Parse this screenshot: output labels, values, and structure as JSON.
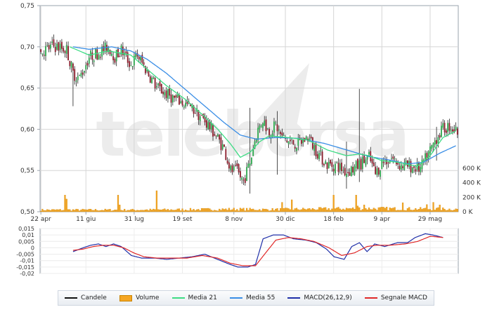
{
  "chart_data": [
    {
      "type": "candlestick",
      "price_axis": {
        "ticks": [
          "0,75",
          "0,70",
          "0,65",
          "0,60",
          "0,55",
          "0,50"
        ],
        "range": [
          0.5,
          0.75
        ]
      },
      "volume_axis": {
        "ticks": [
          "600 K",
          "400 K",
          "200 K",
          "0 K"
        ],
        "range": [
          0,
          850000
        ]
      },
      "x_tick_labels": [
        "22 apr",
        "11 giu",
        "31 lug",
        "19 set",
        "8 nov",
        "30 dic",
        "18 feb",
        "9 apr",
        "29 mag"
      ],
      "grid": true,
      "watermark": "telebórsa",
      "close_knots": [
        [
          0,
          0.694
        ],
        [
          8,
          0.701
        ],
        [
          16,
          0.697
        ],
        [
          20,
          0.668
        ],
        [
          24,
          0.662
        ],
        [
          30,
          0.688
        ],
        [
          36,
          0.693
        ],
        [
          42,
          0.7
        ],
        [
          46,
          0.688
        ],
        [
          50,
          0.696
        ],
        [
          56,
          0.678
        ],
        [
          60,
          0.69
        ],
        [
          66,
          0.67
        ],
        [
          72,
          0.651
        ],
        [
          78,
          0.643
        ],
        [
          84,
          0.636
        ],
        [
          90,
          0.63
        ],
        [
          96,
          0.622
        ],
        [
          102,
          0.61
        ],
        [
          108,
          0.595
        ],
        [
          114,
          0.576
        ],
        [
          118,
          0.55
        ],
        [
          122,
          0.548
        ],
        [
          126,
          0.537
        ],
        [
          130,
          0.56
        ],
        [
          134,
          0.595
        ],
        [
          138,
          0.612
        ],
        [
          142,
          0.596
        ],
        [
          146,
          0.605
        ],
        [
          150,
          0.59
        ],
        [
          154,
          0.585
        ],
        [
          160,
          0.582
        ],
        [
          166,
          0.59
        ],
        [
          172,
          0.572
        ],
        [
          178,
          0.557
        ],
        [
          184,
          0.556
        ],
        [
          190,
          0.548
        ],
        [
          196,
          0.554
        ],
        [
          200,
          0.56
        ],
        [
          204,
          0.566
        ],
        [
          208,
          0.545
        ],
        [
          212,
          0.56
        ],
        [
          218,
          0.565
        ],
        [
          224,
          0.556
        ],
        [
          230,
          0.555
        ],
        [
          236,
          0.552
        ],
        [
          242,
          0.574
        ],
        [
          246,
          0.59
        ],
        [
          250,
          0.6
        ],
        [
          254,
          0.604
        ],
        [
          258,
          0.598
        ]
      ],
      "spikes": [
        {
          "i": 20,
          "high": 0.681,
          "low": 0.628
        },
        {
          "i": 130,
          "high": 0.626,
          "low": 0.522
        },
        {
          "i": 147,
          "high": 0.622,
          "low": 0.545
        },
        {
          "i": 190,
          "high": 0.585,
          "low": 0.528
        },
        {
          "i": 198,
          "high": 0.649,
          "low": 0.536
        },
        {
          "i": 246,
          "high": 0.603,
          "low": 0.562
        }
      ],
      "media21_knots": [
        [
          18,
          0.7
        ],
        [
          30,
          0.69
        ],
        [
          42,
          0.695
        ],
        [
          56,
          0.69
        ],
        [
          66,
          0.673
        ],
        [
          78,
          0.653
        ],
        [
          90,
          0.636
        ],
        [
          102,
          0.615
        ],
        [
          110,
          0.6
        ],
        [
          118,
          0.582
        ],
        [
          124,
          0.566
        ],
        [
          130,
          0.572
        ],
        [
          136,
          0.585
        ],
        [
          142,
          0.592
        ],
        [
          154,
          0.59
        ],
        [
          166,
          0.587
        ],
        [
          178,
          0.575
        ],
        [
          190,
          0.568
        ],
        [
          198,
          0.57
        ],
        [
          204,
          0.568
        ],
        [
          212,
          0.562
        ],
        [
          222,
          0.56
        ],
        [
          234,
          0.555
        ],
        [
          242,
          0.568
        ],
        [
          250,
          0.59
        ],
        [
          258,
          0.598
        ]
      ],
      "media55_knots": [
        [
          20,
          0.7
        ],
        [
          30,
          0.697
        ],
        [
          44,
          0.7
        ],
        [
          56,
          0.695
        ],
        [
          66,
          0.685
        ],
        [
          78,
          0.668
        ],
        [
          90,
          0.648
        ],
        [
          102,
          0.628
        ],
        [
          114,
          0.608
        ],
        [
          124,
          0.593
        ],
        [
          134,
          0.588
        ],
        [
          146,
          0.59
        ],
        [
          160,
          0.589
        ],
        [
          176,
          0.583
        ],
        [
          190,
          0.575
        ],
        [
          204,
          0.567
        ],
        [
          216,
          0.563
        ],
        [
          228,
          0.558
        ],
        [
          238,
          0.56
        ],
        [
          248,
          0.571
        ],
        [
          258,
          0.58
        ]
      ],
      "volume_knots": [
        [
          0,
          25000
        ],
        [
          60,
          25000
        ],
        [
          120,
          35000
        ],
        [
          140,
          30000
        ],
        [
          180,
          40000
        ],
        [
          200,
          45000
        ],
        [
          258,
          35000
        ]
      ],
      "volume_spikes": [
        {
          "i": 15,
          "value": 230000
        },
        {
          "i": 16,
          "value": 175000
        },
        {
          "i": 48,
          "value": 230000
        },
        {
          "i": 49,
          "value": 95000
        },
        {
          "i": 72,
          "value": 290000
        },
        {
          "i": 182,
          "value": 230000
        },
        {
          "i": 196,
          "value": 230000
        },
        {
          "i": 197,
          "value": 80000
        },
        {
          "i": 201,
          "value": 95000
        },
        {
          "i": 225,
          "value": 125000
        },
        {
          "i": 240,
          "value": 100000
        },
        {
          "i": 244,
          "value": 130000
        },
        {
          "i": 248,
          "value": 95000
        },
        {
          "i": 150,
          "value": 130000
        },
        {
          "i": 156,
          "value": 165000
        }
      ],
      "n_sessions": 260
    },
    {
      "type": "line",
      "y_axis": {
        "ticks": [
          "0,015",
          "0,01",
          "0,005",
          "0",
          "-0,005",
          "-0,01",
          "-0,015",
          "-0,02"
        ],
        "range": [
          -0.02,
          0.015
        ]
      },
      "series": [
        {
          "name": "MACD(26,12,9)",
          "color": "#1f2fa8",
          "knots": [
            [
              26,
              -0.003
            ],
            [
              34,
              0.0
            ],
            [
              40,
              0.002
            ],
            [
              46,
              0.003
            ],
            [
              52,
              0.001
            ],
            [
              58,
              0.003
            ],
            [
              64,
              0.001
            ],
            [
              72,
              -0.006
            ],
            [
              80,
              -0.008
            ],
            [
              90,
              -0.008
            ],
            [
              100,
              -0.009
            ],
            [
              110,
              -0.008
            ],
            [
              120,
              -0.007
            ],
            [
              130,
              -0.005
            ],
            [
              140,
              -0.009
            ],
            [
              150,
              -0.013
            ],
            [
              156,
              -0.015
            ],
            [
              164,
              -0.015
            ],
            [
              170,
              -0.013
            ],
            [
              176,
              0.007
            ],
            [
              184,
              0.01
            ],
            [
              192,
              0.01
            ],
            [
              200,
              0.007
            ],
            [
              210,
              0.006
            ],
            [
              218,
              0.004
            ],
            [
              226,
              -0.001
            ],
            [
              232,
              -0.007
            ],
            [
              240,
              -0.009
            ],
            [
              246,
              0.001
            ],
            [
              252,
              0.004
            ],
            [
              258,
              -0.003
            ],
            [
              264,
              0.003
            ],
            [
              272,
              0.001
            ],
            [
              282,
              0.004
            ],
            [
              290,
              0.004
            ],
            [
              296,
              0.008
            ],
            [
              304,
              0.011
            ],
            [
              310,
              0.01
            ],
            [
              318,
              0.008
            ]
          ]
        },
        {
          "name": "Segnale MACD",
          "color": "#e02828",
          "knots": [
            [
              26,
              -0.002
            ],
            [
              34,
              -0.001
            ],
            [
              42,
              0.001
            ],
            [
              50,
              0.002
            ],
            [
              58,
              0.002
            ],
            [
              66,
              0.0
            ],
            [
              74,
              -0.004
            ],
            [
              82,
              -0.007
            ],
            [
              92,
              -0.008
            ],
            [
              104,
              -0.008
            ],
            [
              116,
              -0.008
            ],
            [
              128,
              -0.006
            ],
            [
              140,
              -0.008
            ],
            [
              150,
              -0.012
            ],
            [
              160,
              -0.014
            ],
            [
              170,
              -0.014
            ],
            [
              178,
              -0.004
            ],
            [
              186,
              0.006
            ],
            [
              196,
              0.008
            ],
            [
              206,
              0.007
            ],
            [
              216,
              0.005
            ],
            [
              228,
              0.0
            ],
            [
              238,
              -0.006
            ],
            [
              248,
              -0.004
            ],
            [
              258,
              0.001
            ],
            [
              266,
              0.002
            ],
            [
              276,
              0.002
            ],
            [
              288,
              0.003
            ],
            [
              298,
              0.005
            ],
            [
              308,
              0.009
            ],
            [
              318,
              0.008
            ]
          ]
        }
      ]
    }
  ],
  "legend": [
    {
      "label": "Candele",
      "kind": "line",
      "color": "#111111"
    },
    {
      "label": "Volume",
      "kind": "box",
      "color": "#f5a623"
    },
    {
      "label": "Media 21",
      "kind": "line",
      "color": "#3ddc84"
    },
    {
      "label": "Media 55",
      "kind": "line",
      "color": "#3a8ee6"
    },
    {
      "label": "MACD(26,12,9)",
      "kind": "line",
      "color": "#1f2fa8"
    },
    {
      "label": "Segnale MACD",
      "kind": "line",
      "color": "#e02828"
    }
  ],
  "colors": {
    "candle_up": "#2fa84f",
    "candle_down": "#8b1d2c",
    "volume": "#f5a623",
    "grid": "#d6d6d6",
    "border": "#9aa3ad",
    "watermark": "#ececec"
  }
}
